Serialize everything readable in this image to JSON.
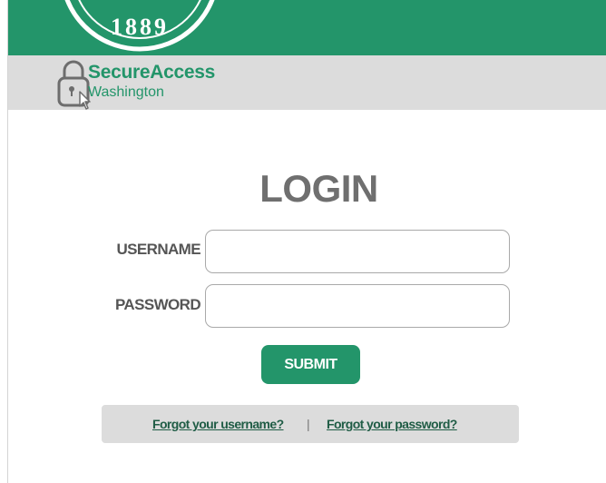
{
  "header": {
    "seal_text": "1889",
    "brand_name": "SecureAccess",
    "brand_sub": "Washington"
  },
  "login": {
    "title": "LOGIN",
    "username_label": "USERNAME",
    "username_value": "",
    "password_label": "PASSWORD",
    "password_value": "",
    "submit_label": "SUBMIT"
  },
  "help": {
    "forgot_username": "Forgot your username?",
    "separator": "|",
    "forgot_password": "Forgot your password?"
  },
  "colors": {
    "brand_green": "#23956a",
    "bar_gray": "#dcdcdc",
    "title_gray": "#6f6f6f"
  }
}
